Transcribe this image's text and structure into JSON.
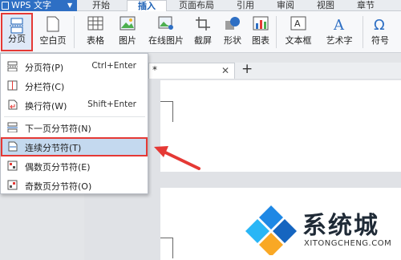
{
  "app": {
    "name": "WPS 文字"
  },
  "tabs": [
    "开始",
    "插入",
    "页面布局",
    "引用",
    "审阅",
    "视图",
    "章节"
  ],
  "active_tab": "插入",
  "ribbon": {
    "page_break": "分页",
    "blank_page": "空白页",
    "table": "表格",
    "picture": "图片",
    "online_picture": "在线图片",
    "screenshot": "截屏",
    "shape": "形状",
    "chart": "图表",
    "textbox": "文本框",
    "wordart": "艺术字",
    "symbol": "符号"
  },
  "doc_tab": {
    "marker": "*"
  },
  "menu": {
    "items": [
      {
        "label": "分页符(P)",
        "shortcut": "Ctrl+Enter"
      },
      {
        "label": "分栏符(C)",
        "shortcut": ""
      },
      {
        "label": "换行符(W)",
        "shortcut": "Shift+Enter"
      },
      {
        "label": "下一页分节符(N)",
        "shortcut": ""
      },
      {
        "label": "连续分节符(T)",
        "shortcut": ""
      },
      {
        "label": "偶数页分节符(E)",
        "shortcut": ""
      },
      {
        "label": "奇数页分节符(O)",
        "shortcut": ""
      }
    ],
    "highlighted": "连续分节符(T)"
  },
  "watermark": {
    "title": "系统城",
    "url": "XITONGCHENG.COM"
  },
  "colors": {
    "accent": "#2e6fc4",
    "highlight_border": "#e53935",
    "menu_highlight": "#c4d9ef"
  }
}
